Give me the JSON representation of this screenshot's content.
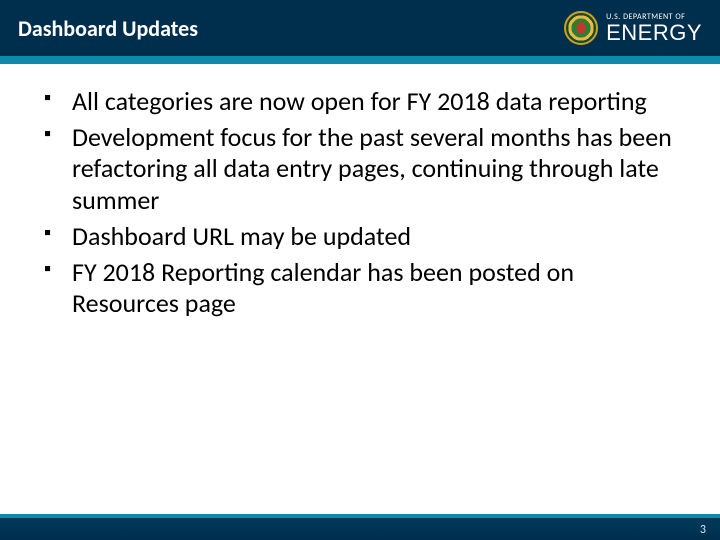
{
  "header": {
    "title": "Dashboard Updates",
    "dept_small": "U.S. DEPARTMENT OF",
    "dept_big": "ENERGY"
  },
  "bullets": [
    "All categories are now open for FY 2018 data reporting",
    "Development focus for the past several months has been refactoring all data entry pages, continuing through late summer",
    "Dashboard URL may be updated",
    "FY 2018 Reporting calendar has been posted on Resources page"
  ],
  "footer": {
    "page_number": "3"
  }
}
